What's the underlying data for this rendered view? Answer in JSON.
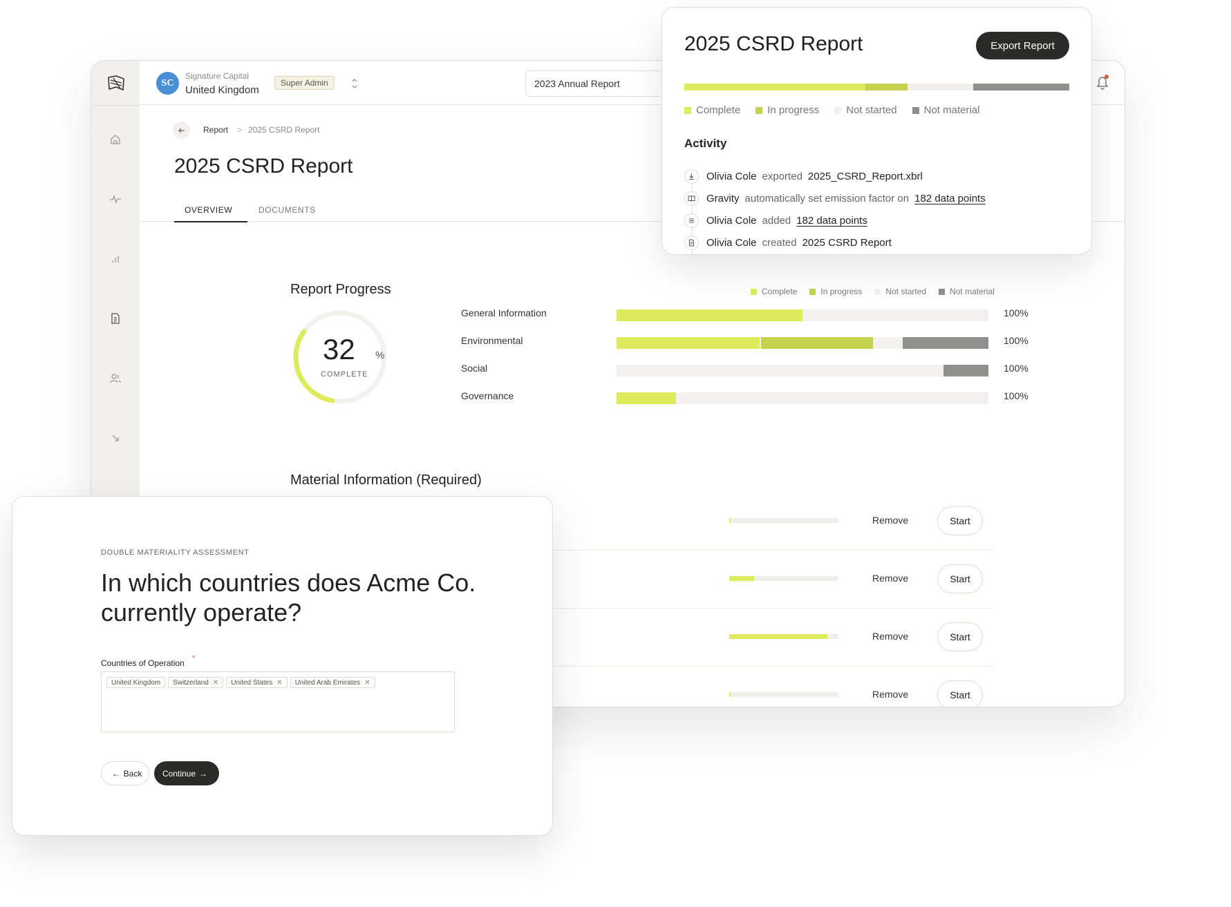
{
  "colors": {
    "complete": "#dcea5c",
    "in_progress": "#c5d24f",
    "not_started": "#f1f0ec",
    "not_material": "#8f8f8b",
    "dark_button": "#2b2b29",
    "accent_dot": "#e25c2b",
    "avatar_blue": "#4a8fd6"
  },
  "topbar": {
    "org_initials": "SC",
    "org_name": "Signature Capital",
    "org_country": "United Kingdom",
    "role_badge": "Super Admin",
    "report_select": "2023 Annual Report"
  },
  "sidebar": {
    "items": [
      "logo-icon",
      "home-icon",
      "activity-icon",
      "bar-chart-icon",
      "document-icon",
      "users-icon",
      "collapse-icon"
    ]
  },
  "breadcrumb": {
    "root": "Report",
    "separator": ">",
    "current": "2025 CSRD Report"
  },
  "page": {
    "title": "2025 CSRD Report",
    "tabs": [
      {
        "label": "OVERVIEW",
        "active": true
      },
      {
        "label": "DOCUMENTS",
        "active": false
      }
    ]
  },
  "legend": [
    "Complete",
    "In progress",
    "Not started",
    "Not material"
  ],
  "report_progress": {
    "title": "Report Progress",
    "percent_value": "32",
    "percent_sign": "%",
    "percent_fraction": 0.32,
    "caption": "COMPLETE",
    "rows": [
      {
        "label": "General Information",
        "pct_label": "100%",
        "complete": 0.5,
        "in_progress": 0,
        "not_material": 0
      },
      {
        "label": "Environmental",
        "pct_label": "100%",
        "complete": 0.385,
        "in_progress": 0.3,
        "not_material": 0.23
      },
      {
        "label": "Social",
        "pct_label": "100%",
        "complete": 0,
        "in_progress": 0,
        "not_material": 0.12
      },
      {
        "label": "Governance",
        "pct_label": "100%",
        "complete": 0.16,
        "in_progress": 0,
        "not_material": 0
      }
    ]
  },
  "material_information": {
    "title": "Material Information (Required)",
    "rows": [
      {
        "progress": 0.01,
        "remove_label": "Remove",
        "start_label": "Start"
      },
      {
        "progress": 0.23,
        "remove_label": "Remove",
        "start_label": "Start"
      },
      {
        "progress": 0.9,
        "remove_label": "Remove",
        "start_label": "Start"
      },
      {
        "progress": 0.01,
        "remove_label": "Remove",
        "start_label": "Start"
      }
    ]
  },
  "report_card": {
    "title": "2025 CSRD Report",
    "export_label": "Export Report",
    "bar": {
      "complete": 0.47,
      "in_progress": 0.11,
      "not_started": 0.17,
      "not_material": 0.25
    },
    "activity_title": "Activity",
    "activity": [
      {
        "icon": "download-icon",
        "who": "Olivia Cole",
        "verb": "exported",
        "object": "2025_CSRD_Report.xbrl",
        "object_is_link": false
      },
      {
        "icon": "book-icon",
        "who": "Gravity",
        "verb": "automatically set emission factor on",
        "object": "182 data points",
        "object_is_link": true
      },
      {
        "icon": "list-icon",
        "who": "Olivia Cole",
        "verb": "added",
        "object": "182 data points",
        "object_is_link": true
      },
      {
        "icon": "file-icon",
        "who": "Olivia Cole",
        "verb": "created",
        "object": "2025  CSRD Report",
        "object_is_link": false
      }
    ]
  },
  "assessment": {
    "eyebrow": "DOUBLE MATERIALITY ASSESSMENT",
    "question": "In which countries does Acme Co. currently operate?",
    "field_label": "Countries of Operation",
    "required_mark": "*",
    "chips": [
      {
        "label": "United Kingdom",
        "removable": false
      },
      {
        "label": "Switzerland",
        "removable": true
      },
      {
        "label": "United States",
        "removable": true
      },
      {
        "label": "United Arab Emirates",
        "removable": true
      }
    ],
    "back_label": "Back",
    "continue_label": "Continue"
  }
}
